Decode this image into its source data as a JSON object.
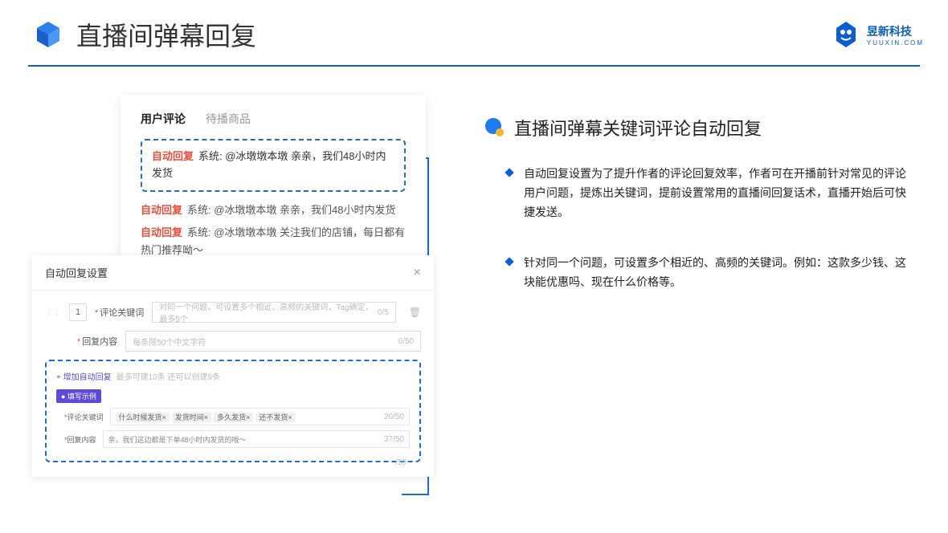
{
  "header": {
    "title": "直播间弹幕回复",
    "logo_cn": "昱新科技",
    "logo_en": "YUUXIN.COM"
  },
  "comments_card": {
    "tab_active": "用户评论",
    "tab_inactive": "待播商品",
    "highlight_badge": "自动回复",
    "highlight_text": "系统: @冰墩墩本墩 亲亲，我们48小时内发货",
    "line2_badge": "自动回复",
    "line2_text": "系统: @冰墩墩本墩 亲亲，我们48小时内发货",
    "line3_badge": "自动回复",
    "line3_text": "系统: @冰墩墩本墩 关注我们的店铺，每日都有热门推荐呦～"
  },
  "modal": {
    "title": "自动回复设置",
    "num": "1",
    "kw_label": "评论关键词",
    "kw_placeholder": "对同一个问题，可设置多个相近、高频的关键词，Tag确定，最多5个",
    "kw_count": "0/5",
    "content_label": "回复内容",
    "content_placeholder": "每条限50个中文字符",
    "content_count": "0/50",
    "add_link": "+ 增加自动回复",
    "add_tip": "最多可建10条 还可以创建9条",
    "ex_badge": "● 填写示例",
    "ex_kw_label": "评论关键词",
    "ex_tags": [
      "什么时候发货×",
      "发货时间×",
      "多久发货×",
      "还不发货×"
    ],
    "ex_kw_count": "20/50",
    "ex_content_label": "回复内容",
    "ex_content_value": "亲，我们这边都是下单48小时内发货的哦～",
    "ex_content_count": "37/50",
    "stray_count": "/50"
  },
  "right": {
    "title": "直播间弹幕关键词评论自动回复",
    "bullet1": "自动回复设置为了提升作者的评论回复效率，作者可在开播前针对常见的评论用户问题，提炼出关键词，提前设置常用的直播间回复话术，直播开始后可快捷发送。",
    "bullet2": "针对同一个问题，可设置多个相近的、高频的关键词。例如：这款多少钱、这块能优惠吗、现在什么价格等。"
  }
}
